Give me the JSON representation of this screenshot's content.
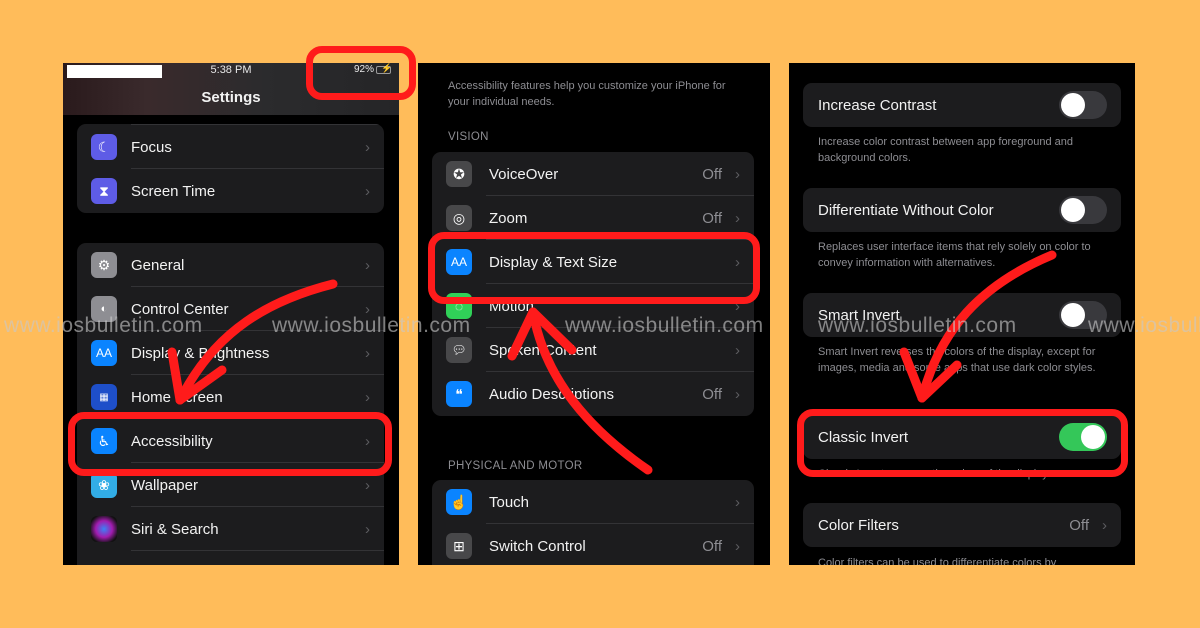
{
  "colors": {
    "background": "#FFBC5A",
    "panel": "#000000",
    "group": "#1C1C1E",
    "highlight": "#FF1B1B",
    "toggle_on": "#34C759",
    "secondary_text": "#8D8D92"
  },
  "panel1": {
    "status_time": "5:38 PM",
    "battery_percent": "92%",
    "title": "Settings",
    "groups": [
      {
        "items": [
          {
            "label": "Focus",
            "icon": "moon-icon"
          },
          {
            "label": "Screen Time",
            "icon": "hourglass-icon"
          }
        ]
      },
      {
        "items": [
          {
            "label": "General",
            "icon": "gear-icon"
          },
          {
            "label": "Control Center",
            "icon": "toggles-icon"
          },
          {
            "label": "Display & Brightness",
            "icon": "text-size-icon"
          },
          {
            "label": "Home Screen",
            "icon": "app-grid-icon"
          },
          {
            "label": "Accessibility",
            "icon": "accessibility-icon",
            "highlighted": true
          },
          {
            "label": "Wallpaper",
            "icon": "flower-icon"
          },
          {
            "label": "Siri & Search",
            "icon": "siri-icon"
          }
        ]
      }
    ]
  },
  "panel2": {
    "intro": "Accessibility features help you customize your iPhone for your individual needs.",
    "vision_header": "VISION",
    "vision_items": [
      {
        "label": "VoiceOver",
        "value": "Off",
        "icon": "voiceover-icon"
      },
      {
        "label": "Zoom",
        "value": "Off",
        "icon": "zoom-icon"
      },
      {
        "label": "Display & Text Size",
        "value": "",
        "icon": "text-size-icon",
        "highlighted": true
      },
      {
        "label": "Motion",
        "value": "",
        "icon": "motion-icon"
      },
      {
        "label": "Spoken Content",
        "value": "",
        "icon": "speech-bubble-icon"
      },
      {
        "label": "Audio Descriptions",
        "value": "Off",
        "icon": "quote-bubble-icon"
      }
    ],
    "physical_header": "PHYSICAL AND MOTOR",
    "physical_items": [
      {
        "label": "Touch",
        "value": "",
        "icon": "hand-touch-icon"
      },
      {
        "label": "Switch Control",
        "value": "Off",
        "icon": "switch-grid-icon"
      }
    ]
  },
  "panel3": {
    "items": [
      {
        "label": "Increase Contrast",
        "on": false,
        "description": "Increase color contrast between app foreground and background colors."
      },
      {
        "label": "Differentiate Without Color",
        "on": false,
        "description": "Replaces user interface items that rely solely on color to convey information with alternatives."
      },
      {
        "label": "Smart Invert",
        "on": false,
        "description": "Smart Invert reverses the colors of the display, except for images, media and some apps that use dark color styles."
      },
      {
        "label": "Classic Invert",
        "on": true,
        "highlighted": true,
        "description": "Classic Invert reverses the colors of the display."
      }
    ],
    "color_filters": {
      "label": "Color Filters",
      "value": "Off",
      "description": "Color filters can be used to differentiate colors by"
    }
  },
  "watermark": "www.iosbulletin.com",
  "chevron": "›"
}
